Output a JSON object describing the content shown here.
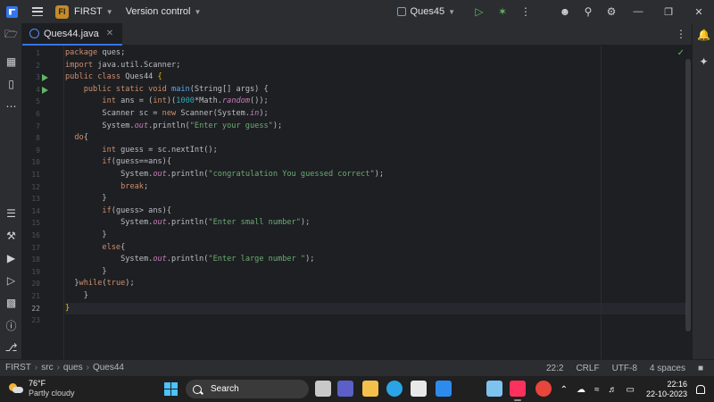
{
  "titlebar": {
    "project_badge": "FI",
    "project_name": "FIRST",
    "version_control": "Version control",
    "run_config": "Ques45"
  },
  "editor": {
    "tab_label": "Ques44.java",
    "lines": [
      {
        "n": "1",
        "html": "<span class=\"kw\">package</span> ques;"
      },
      {
        "n": "2",
        "html": "<span class=\"kw\">import</span> java.util.Scanner;"
      },
      {
        "n": "3",
        "html": "<span class=\"kw\">public class</span> Ques44 <span class=\"brace\">{</span>"
      },
      {
        "n": "4",
        "html": "    <span class=\"kw\">public static void</span> <span class=\"fn\">main</span>(String[] args) {"
      },
      {
        "n": "5",
        "html": "        <span class=\"kw\">int</span> ans = (<span class=\"kw\">int</span>)(<span class=\"num\">1000</span>*Math.<span class=\"ital\">random</span>());"
      },
      {
        "n": "6",
        "html": "        Scanner sc = <span class=\"kw\">new</span> Scanner(System.<span class=\"field\">in</span>);"
      },
      {
        "n": "7",
        "html": "        System.<span class=\"field\">out</span>.println(<span class=\"str\">\"Enter your guess\"</span>);"
      },
      {
        "n": "8",
        "html": "  <span class=\"kw\">do</span>{"
      },
      {
        "n": "9",
        "html": "        <span class=\"kw\">int</span> guess = sc.nextInt();"
      },
      {
        "n": "10",
        "html": "        <span class=\"kw\">if</span>(guess==ans){"
      },
      {
        "n": "11",
        "html": "            System.<span class=\"field\">out</span>.println(<span class=\"str\">\"congratulation You guessed correct\"</span>);"
      },
      {
        "n": "12",
        "html": "            <span class=\"kw\">break</span>;"
      },
      {
        "n": "13",
        "html": "        }"
      },
      {
        "n": "14",
        "html": "        <span class=\"kw\">if</span>(guess> ans){"
      },
      {
        "n": "15",
        "html": "            System.<span class=\"field\">out</span>.println(<span class=\"str\">\"Enter small number\"</span>);"
      },
      {
        "n": "16",
        "html": "        }"
      },
      {
        "n": "17",
        "html": "        <span class=\"kw\">else</span>{"
      },
      {
        "n": "18",
        "html": "            System.<span class=\"field\">out</span>.println(<span class=\"str\">\"Enter large number \"</span>);"
      },
      {
        "n": "19",
        "html": "        }"
      },
      {
        "n": "20",
        "html": "  }<span class=\"kw\">while</span>(<span class=\"kw\">true</span>);"
      },
      {
        "n": "21",
        "html": "    }"
      },
      {
        "n": "22",
        "html": "<span class=\"brace\">}</span>"
      },
      {
        "n": "23",
        "html": ""
      }
    ],
    "current_line": "22",
    "runnable_lines": [
      "3",
      "4"
    ]
  },
  "statusbar": {
    "breadcrumb": [
      "FIRST",
      "src",
      "ques",
      "Ques44"
    ],
    "position": "22:2",
    "line_separator": "CRLF",
    "encoding": "UTF-8",
    "indent": "4 spaces"
  },
  "taskbar": {
    "weather_temp": "76°F",
    "weather_desc": "Partly cloudy",
    "search_label": "Search",
    "time": "22:16",
    "date": "22-10-2023",
    "apps": [
      {
        "name": "file-manager-icon",
        "color": "#c9c9c9"
      },
      {
        "name": "video-call-icon",
        "color": "#5b5fc7"
      },
      {
        "name": "folder-icon",
        "color": "#f2c04b"
      },
      {
        "name": "edge-icon",
        "color": "#2aa4e6"
      },
      {
        "name": "store-icon",
        "color": "#e8e8e8"
      },
      {
        "name": "dropbox-icon",
        "color": "#2d8bf0"
      },
      {
        "name": "notepad-icon",
        "color": "#7ec2f0"
      },
      {
        "name": "intellij-icon",
        "color": "#fe315d"
      },
      {
        "name": "chrome-icon",
        "color": "#e8453c"
      }
    ]
  }
}
